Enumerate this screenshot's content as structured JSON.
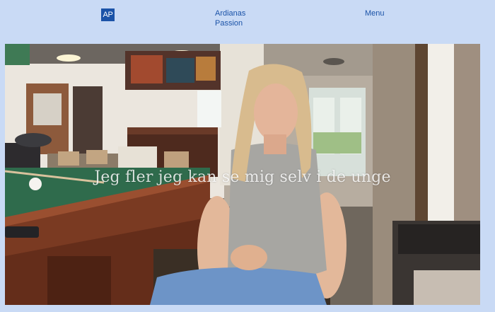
{
  "header": {
    "logo_text": "AP",
    "site_title_line1": "Ardianas",
    "site_title_line2": "Passion",
    "menu_label": "Menu"
  },
  "video": {
    "subtitle": "Jeg fler jeg kan se mig selv i de unge"
  },
  "colors": {
    "page_background": "#c9daf5",
    "brand_blue": "#1b53a8"
  }
}
